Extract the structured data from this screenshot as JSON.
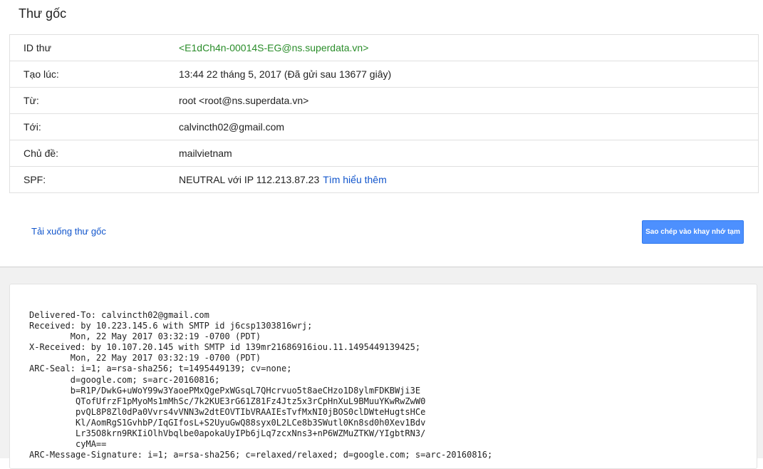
{
  "page": {
    "title": "Thư gốc"
  },
  "info": {
    "rows": [
      {
        "label": "ID thư",
        "value": "<E1dCh4n-00014S-EG@ns.superdata.vn>"
      },
      {
        "label": "Tạo lúc:",
        "value": "13:44 22 tháng 5, 2017 (Đã gửi sau 13677 giây)"
      },
      {
        "label": "Từ:",
        "value": "root <root@ns.superdata.vn>"
      },
      {
        "label": "Tới:",
        "value": "calvincth02@gmail.com"
      },
      {
        "label": "Chủ đề:",
        "value": "mailvietnam"
      },
      {
        "label": "SPF:",
        "value": "NEUTRAL với IP 112.213.87.23",
        "link": "Tìm hiểu thêm"
      }
    ]
  },
  "actions": {
    "download_label": "Tải xuống thư gốc",
    "copy_label": "Sao chép vào khay nhớ tạm"
  },
  "raw": {
    "text": "Delivered-To: calvincth02@gmail.com\nReceived: by 10.223.145.6 with SMTP id j6csp1303816wrj;\n        Mon, 22 May 2017 03:32:19 -0700 (PDT)\nX-Received: by 10.107.20.145 with SMTP id 139mr21686916iou.11.1495449139425;\n        Mon, 22 May 2017 03:32:19 -0700 (PDT)\nARC-Seal: i=1; a=rsa-sha256; t=1495449139; cv=none;\n        d=google.com; s=arc-20160816;\n        b=R1P/DwkG+uWoY99w3YaoePMxQgePxWGsqL7QHcrvuo5t8aeCHzo1D8ylmFDKBWji3E\n         QTofUfrzF1pMyoMs1mMhSc/7k2KUE3rG61Z81Fz4Jtz5x3rCpHnXuL9BMuuYKwRwZwW0\n         pvQL8P8Zl0dPa0Vvrs4vVNN3w2dtEOVTIbVRAAIEsTvfMxNI0jBOS0clDWteHugtsHCe\n         Kl/AomRgS1GvhbP/IqGIfosL+S2UyuGwQ88syx0L2LCe8b3SWutl0Kn8sd0h0Xev1Bdv\n         Lr35O8krn9RKIiOlhVbqlbe0apokaUyIPb6jLq7zcxNns3+nP6WZMuZTKW/YIgbtRN3/\n         cyMA==\nARC-Message-Signature: i=1; a=rsa-sha256; c=relaxed/relaxed; d=google.com; s=arc-20160816;"
  },
  "colors": {
    "accent": "#4d90fe",
    "link": "#1155cc",
    "message_id": "#2a8d2a",
    "background_lower": "#f1f1f1"
  }
}
